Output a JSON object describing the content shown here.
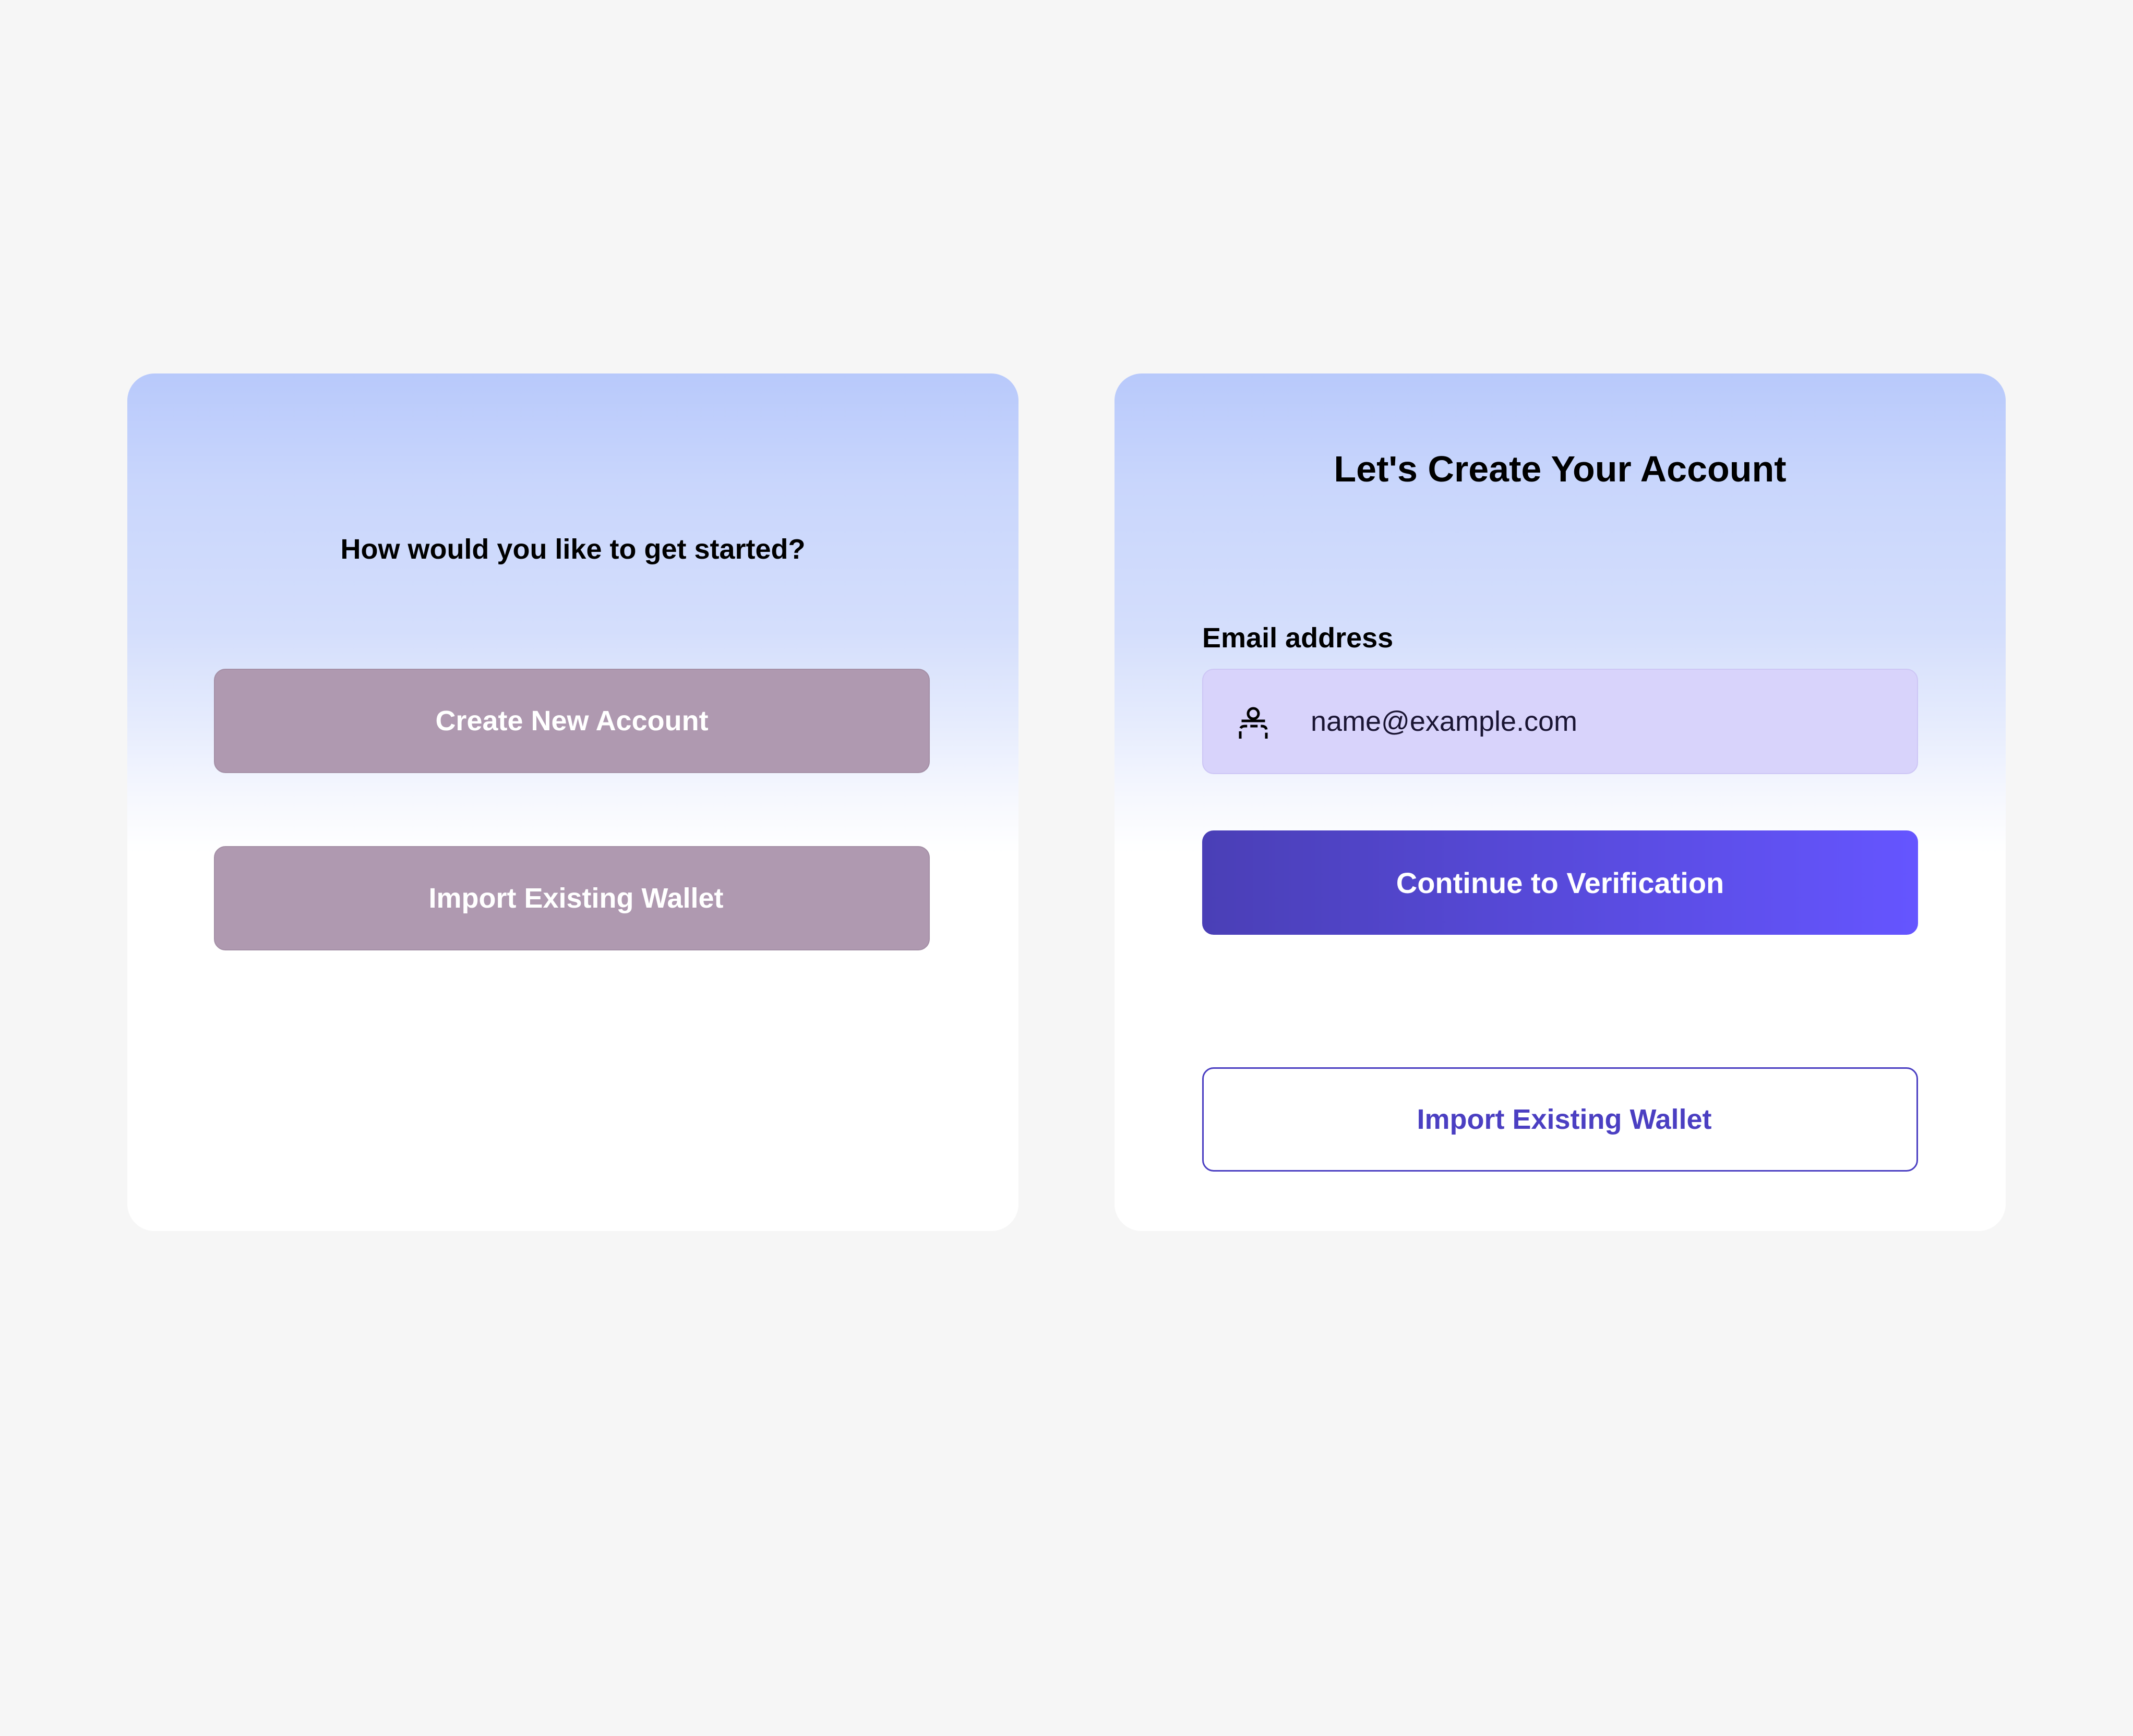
{
  "start_card": {
    "question": "How would you like to get started?",
    "create_label": "Create New Account",
    "import_label": "Import Existing Wallet"
  },
  "create_card": {
    "title": "Let's Create Your Account",
    "email_label": "Email address",
    "email_value": "name@example.com",
    "email_icon": "user-icon",
    "continue_label": "Continue to Verification",
    "import_label": "Import Existing Wallet"
  },
  "colors": {
    "page_background": "#f6f6f6",
    "muted_button": "#af99b0",
    "input_background": "#d8d3fb",
    "primary_start": "#4a3fb6",
    "primary_end": "#6555ff",
    "outline_accent": "#4b3fc2"
  }
}
